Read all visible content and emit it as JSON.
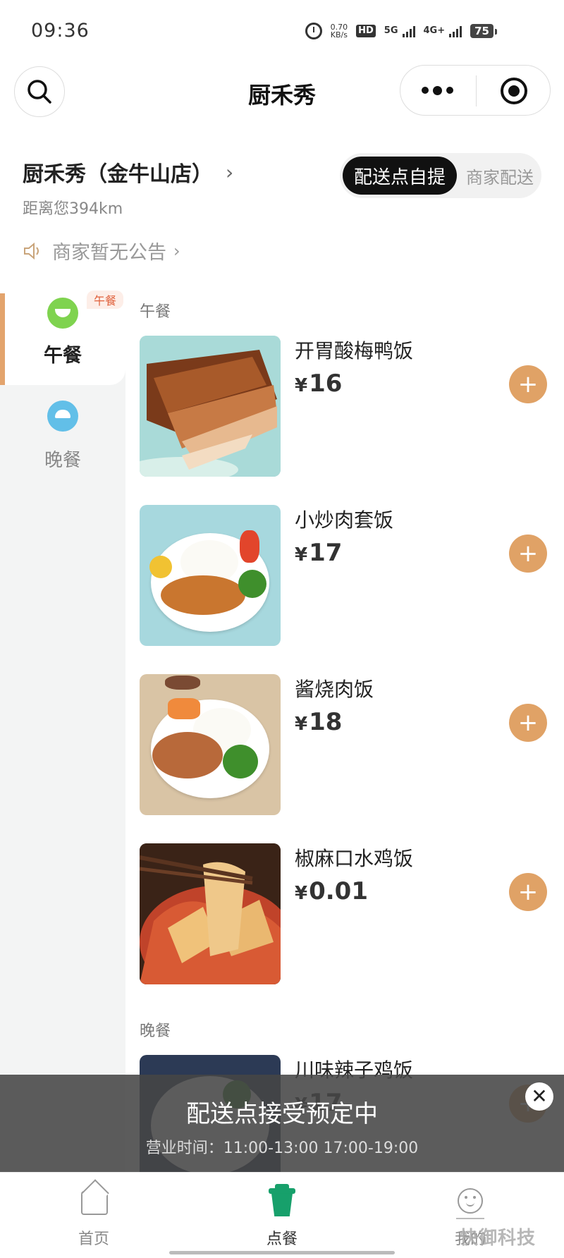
{
  "status_bar": {
    "time": "09:36",
    "speed_value": "0.70",
    "speed_unit": "KB/s",
    "hd_label": "HD",
    "net_5g": "5G",
    "net_4g": "4G+",
    "battery": "75"
  },
  "nav": {
    "title": "厨禾秀"
  },
  "store": {
    "name": "厨禾秀（金牛山店）",
    "distance": "距离您394km",
    "delivery_options": [
      "配送点自提",
      "商家配送"
    ],
    "selected_option": "配送点自提",
    "notice": "商家暂无公告"
  },
  "sidebar": {
    "categories": [
      {
        "label": "午餐",
        "badge": "午餐",
        "active": true
      },
      {
        "label": "晚餐",
        "active": false
      }
    ]
  },
  "menu": {
    "sections": [
      {
        "title": "午餐",
        "items": [
          {
            "name": "开胃酸梅鸭饭",
            "currency": "¥",
            "price": "16"
          },
          {
            "name": "小炒肉套饭",
            "currency": "¥",
            "price": "17"
          },
          {
            "name": "酱烧肉饭",
            "currency": "¥",
            "price": "18"
          },
          {
            "name": "椒麻口水鸡饭",
            "currency": "¥",
            "price": "0.01"
          }
        ]
      },
      {
        "title": "晚餐",
        "items": [
          {
            "name": "川味辣子鸡饭",
            "currency": "¥",
            "price": "17"
          }
        ]
      }
    ],
    "add_symbol": "+"
  },
  "banner": {
    "title": "配送点接受预定中",
    "hours": "营业时间：11:00-13:00 17:00-19:00",
    "close_symbol": "✕"
  },
  "tab_bar": {
    "tabs": [
      {
        "label": "首页",
        "active": false
      },
      {
        "label": "点餐",
        "active": true
      },
      {
        "label": "我的",
        "active": false
      }
    ]
  },
  "watermark": "快御科技",
  "colors": {
    "accent": "#e0a266",
    "active_tab": "#17a06b",
    "sidebar_indicator": "#e3a46d",
    "badge_text": "#e0613c"
  }
}
